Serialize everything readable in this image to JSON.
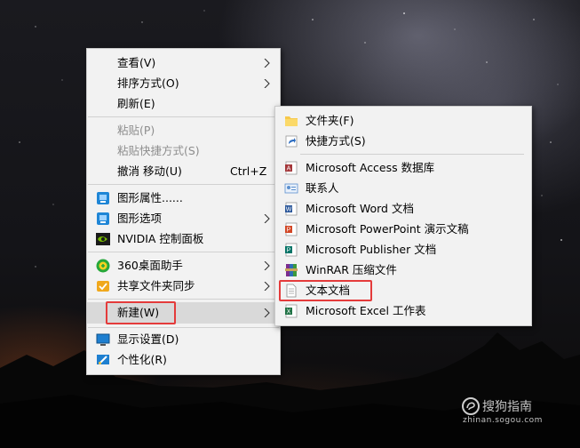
{
  "context_menu": {
    "items": [
      {
        "label": "查看(V)",
        "has_submenu": true
      },
      {
        "label": "排序方式(O)",
        "has_submenu": true
      },
      {
        "label": "刷新(E)"
      },
      {
        "label": "粘贴(P)",
        "disabled": true
      },
      {
        "label": "粘贴快捷方式(S)",
        "disabled": true
      },
      {
        "label": "撤消 移动(U)",
        "shortcut": "Ctrl+Z"
      },
      {
        "label": "图形属性......",
        "icon": "graphics-properties-icon"
      },
      {
        "label": "图形选项",
        "icon": "graphics-options-icon",
        "has_submenu": true
      },
      {
        "label": "NVIDIA 控制面板",
        "icon": "nvidia-icon"
      },
      {
        "label": "360桌面助手",
        "icon": "360-desktop-icon",
        "has_submenu": true
      },
      {
        "label": "共享文件夹同步",
        "icon": "shared-folder-sync-icon",
        "has_submenu": true
      },
      {
        "label": "新建(W)",
        "has_submenu": true,
        "highlighted": true
      },
      {
        "label": "显示设置(D)",
        "icon": "display-settings-icon"
      },
      {
        "label": "个性化(R)",
        "icon": "personalize-icon"
      }
    ]
  },
  "new_submenu": {
    "items": [
      {
        "label": "文件夹(F)",
        "icon": "folder-icon"
      },
      {
        "label": "快捷方式(S)",
        "icon": "shortcut-icon"
      },
      {
        "label": "Microsoft Access 数据库",
        "icon": "access-icon"
      },
      {
        "label": "联系人",
        "icon": "contact-icon"
      },
      {
        "label": "Microsoft Word 文档",
        "icon": "word-icon"
      },
      {
        "label": "Microsoft PowerPoint 演示文稿",
        "icon": "powerpoint-icon"
      },
      {
        "label": "Microsoft Publisher 文档",
        "icon": "publisher-icon"
      },
      {
        "label": "WinRAR 压缩文件",
        "icon": "winrar-icon"
      },
      {
        "label": "文本文档",
        "icon": "text-document-icon",
        "marked": true
      },
      {
        "label": "Microsoft Excel 工作表",
        "icon": "excel-icon"
      }
    ]
  },
  "watermark": {
    "brand": "搜狗指南",
    "url": "zhinan.sogou.com"
  },
  "colors": {
    "menu_bg": "#f2f2f2",
    "highlight_bg": "#d9d9d9",
    "annotation_red": "#e43b3b",
    "disabled_text": "#8d8d8d"
  }
}
